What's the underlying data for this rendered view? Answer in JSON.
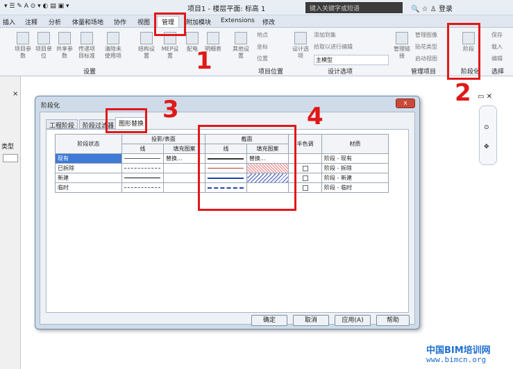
{
  "window": {
    "title": "项目1 - 楼层平面: 标高 1",
    "search_placeholder": "键入关键字或短语",
    "login": "登录"
  },
  "tabs": [
    "插入",
    "注释",
    "分析",
    "体量和场地",
    "协作",
    "视图",
    "管理",
    "附加模块",
    "Extensions",
    "修改"
  ],
  "ribbon": {
    "buttons": [
      "项目参数",
      "项目单位",
      "共享参数",
      "传递项目标准",
      "清除未使用项",
      "结构设置",
      "MEP设置",
      "配电",
      "明细表",
      "其他设置",
      "设计选项",
      "管理链接",
      "阶段"
    ],
    "small_items": [
      "地点",
      "坐标",
      "位置",
      "添加到集",
      "拾取以进行编辑",
      "主模型",
      "管理图像",
      "贴花类型",
      "启动视图",
      "保存",
      "载入",
      "编辑"
    ],
    "groups": [
      "设置",
      "项目位置",
      "设计选项",
      "管理项目",
      "阶段化",
      "选择"
    ]
  },
  "left_panel": {
    "label": "类型"
  },
  "dialog": {
    "title": "阶段化",
    "close": "x",
    "tabs": [
      "工程阶段",
      "阶段过滤器",
      "图形替换"
    ],
    "active_tab": "图形替换",
    "headers": {
      "phase_status": "阶段状态",
      "projection": "投影/表面",
      "cut": "截面",
      "halftone": "半色调",
      "material": "材质",
      "line": "线",
      "fill": "填充图案"
    },
    "rows": [
      {
        "status": "现有",
        "fill": "替换...",
        "cut_fill": "替换...",
        "material": "阶段 - 现有",
        "selected": true
      },
      {
        "status": "已拆除",
        "fill": "",
        "cut_fill": "",
        "material": "阶段 - 拆除",
        "selected": false
      },
      {
        "status": "新建",
        "fill": "",
        "cut_fill": "",
        "material": "阶段 - 新建",
        "selected": false
      },
      {
        "status": "临时",
        "fill": "",
        "cut_fill": "",
        "material": "阶段 - 临时",
        "selected": false
      }
    ],
    "buttons": {
      "ok": "确定",
      "cancel": "取消",
      "apply": "应用(A)",
      "help": "帮助"
    }
  },
  "annotations": [
    "1",
    "2",
    "3",
    "4"
  ],
  "watermark": {
    "line1": "中国BIM培训网",
    "line2": "www.bimcn.org"
  },
  "colors": {
    "accent": "#3d7bd6",
    "annotation": "#e01818",
    "watermark": "#1f6fd1"
  }
}
